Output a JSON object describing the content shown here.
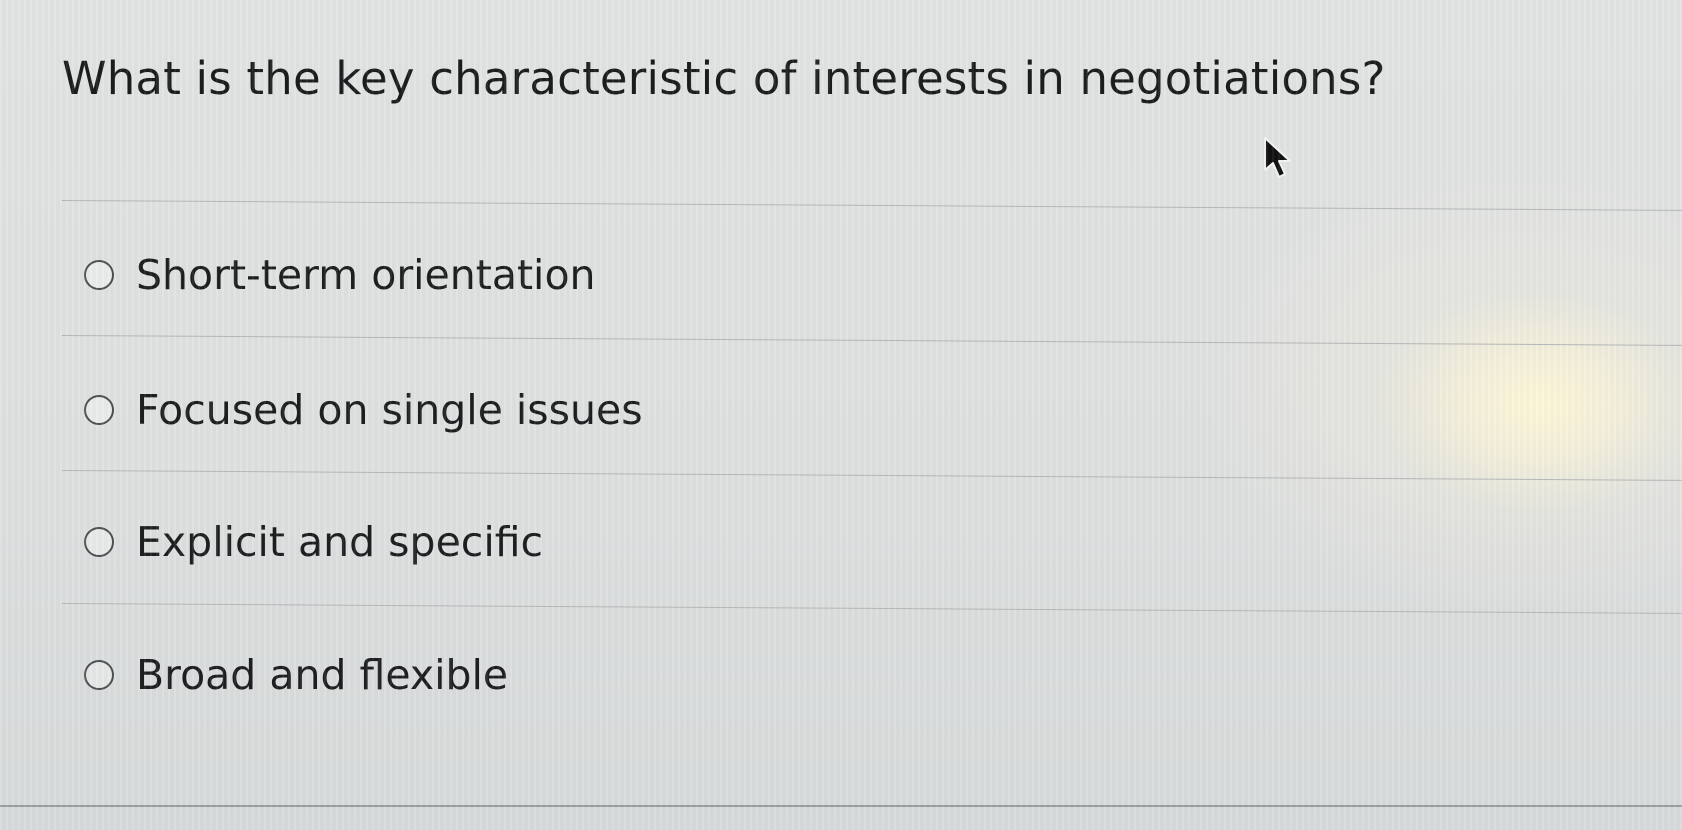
{
  "question": {
    "text": "What is the key characteristic of interests in negotiations?"
  },
  "options": [
    {
      "label": "Short-term orientation",
      "selected": false
    },
    {
      "label": "Focused on single issues",
      "selected": false
    },
    {
      "label": "Explicit and specific",
      "selected": false
    },
    {
      "label": "Broad and flexible",
      "selected": false
    }
  ],
  "cursor": {
    "icon": "mouse-pointer-icon"
  }
}
